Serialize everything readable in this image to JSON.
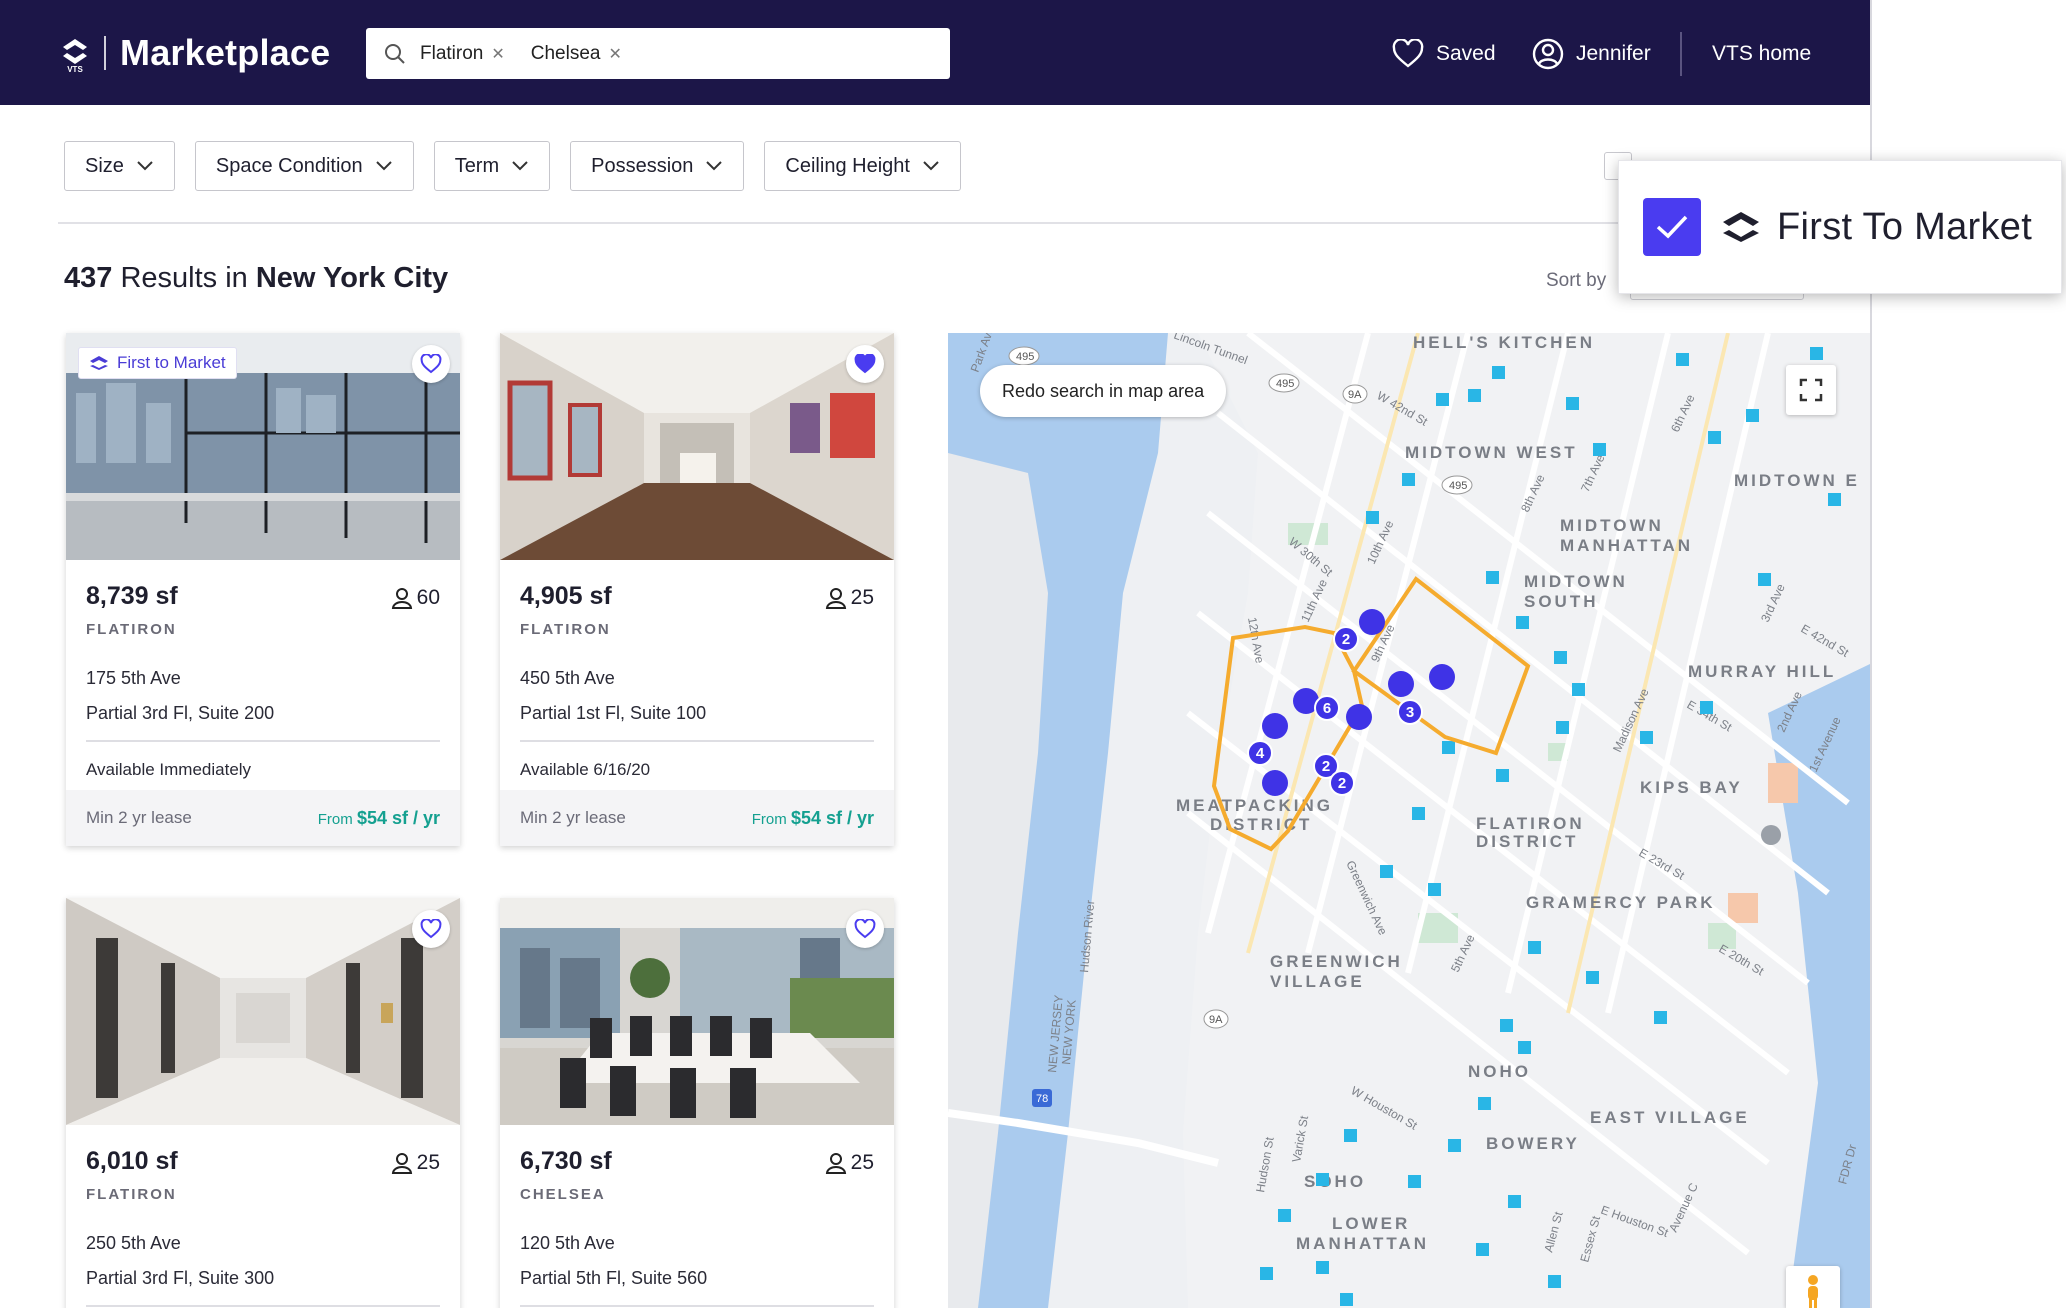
{
  "header": {
    "brand": "Marketplace",
    "logo_text": "VTS",
    "search_chips": [
      "Flatiron",
      "Chelsea"
    ],
    "saved_label": "Saved",
    "user_label": "Jennifer",
    "home_label": "VTS home",
    "colors": {
      "bg": "#1c1648",
      "accent": "#4a3cf0"
    }
  },
  "filters": [
    "Size",
    "Space Condition",
    "Term",
    "Possession",
    "Ceiling Height"
  ],
  "results": {
    "count": "437",
    "mid": " Results in ",
    "city": "New York City",
    "sort_label": "Sort by"
  },
  "popover": {
    "label": "First To Market",
    "checked": true
  },
  "listings": [
    {
      "badge": "First to Market",
      "favorited": false,
      "size": "8,739 sf",
      "people": "60",
      "neighborhood": "FLATIRON",
      "address": "175 5th Ave",
      "suite": "Partial 3rd Fl, Suite 200",
      "availability": "Available Immediately",
      "lease": "Min 2 yr lease",
      "price_prefix": "From ",
      "price": "$54 sf / yr"
    },
    {
      "badge": "",
      "favorited": true,
      "size": "4,905 sf",
      "people": "25",
      "neighborhood": "FLATIRON",
      "address": "450 5th Ave",
      "suite": "Partial 1st Fl, Suite 100",
      "availability": "Available 6/16/20",
      "lease": "Min 2 yr lease",
      "price_prefix": "From ",
      "price": "$54 sf / yr"
    },
    {
      "badge": "",
      "favorited": false,
      "size": "6,010 sf",
      "people": "25",
      "neighborhood": "FLATIRON",
      "address": "250 5th Ave",
      "suite": "Partial 3rd Fl, Suite 300"
    },
    {
      "badge": "",
      "favorited": false,
      "size": "6,730 sf",
      "people": "25",
      "neighborhood": "CHELSEA",
      "address": "120 5th Ave",
      "suite": "Partial 5th Fl, Suite 560"
    }
  ],
  "map": {
    "redo_label": "Redo search in map area",
    "neighborhoods": [
      "HELL'S KITCHEN",
      "MIDTOWN WEST",
      "MIDTOWN",
      "MANHATTAN",
      "MIDTOWN",
      "SOUTH",
      "MURRAY HILL",
      "KIPS BAY",
      "MEATPACKING",
      "DISTRICT",
      "FLATIRON",
      "DISTRICT",
      "GRAMERCY PARK",
      "GREENWICH",
      "VILLAGE",
      "NOHO",
      "EAST VILLAGE",
      "BOWERY",
      "SOHO",
      "LOWER",
      "MANHATTAN",
      "MIDTOWN E"
    ],
    "streets": [
      "W 42nd St",
      "W 30th St",
      "10th Ave",
      "11th Ave",
      "12th Ave",
      "8th Ave",
      "7th Ave",
      "6th Ave",
      "9th Ave",
      "Madison Ave",
      "5th Ave",
      "3rd Ave",
      "2nd Ave",
      "1st Avenue",
      "E 34th St",
      "E 42nd St",
      "E 23rd St",
      "E 20th St",
      "Greenwich Ave",
      "W Houston St",
      "E Houston St",
      "Hudson St",
      "Varick St",
      "Allen St",
      "Essex St",
      "Avenue C",
      "FDR Dr",
      "Park Ave",
      "Lincoln Tunnel",
      "NEW JERSEY",
      "NEW YORK",
      "Hudson River"
    ],
    "route_shields": [
      "495",
      "495",
      "495",
      "9A",
      "9A",
      "78"
    ],
    "cluster_counts": [
      "2",
      "6",
      "3",
      "4",
      "2",
      "2"
    ]
  }
}
